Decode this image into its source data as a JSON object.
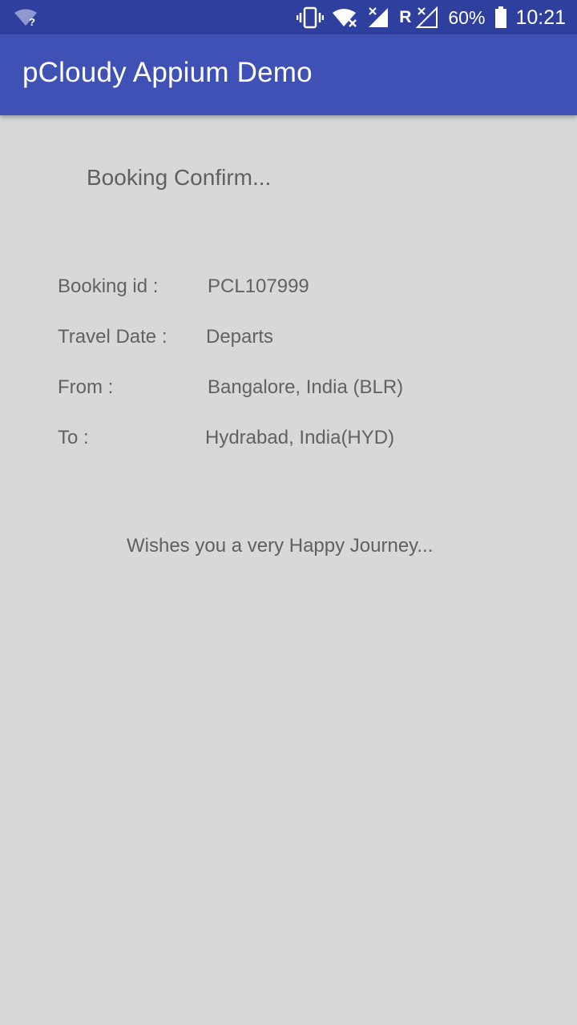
{
  "status_bar": {
    "battery": "60%",
    "time": "10:21",
    "network_letter": "R",
    "icons": [
      "wifi-unknown-icon",
      "vibrate-icon",
      "wifi-no-data-icon",
      "signal-no-data-icon",
      "roaming-signal-icon",
      "battery-icon"
    ]
  },
  "app_bar": {
    "title": "pCloudy Appium Demo",
    "color": "#3f51b5"
  },
  "booking": {
    "heading": "Booking Confirm...",
    "rows": [
      {
        "label": "Booking id :",
        "value": "PCL107999"
      },
      {
        "label": "Travel Date :",
        "value": "Departs"
      },
      {
        "label": "From :",
        "value": "Bangalore, India (BLR)"
      },
      {
        "label": "To :",
        "value": "Hydrabad, India(HYD)"
      }
    ],
    "wishes": "Wishes you a very Happy Journey..."
  }
}
